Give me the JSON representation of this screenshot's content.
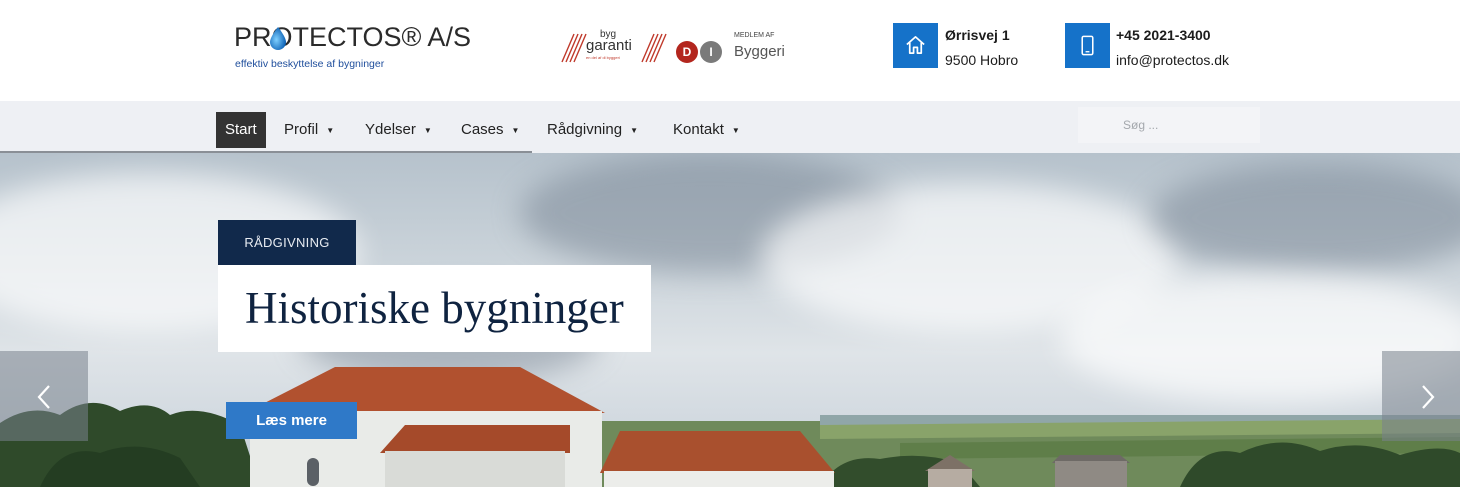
{
  "header": {
    "logo": {
      "name": "PROTECTOS® A/S",
      "tagline": "effektiv beskyttelse af bygninger"
    },
    "byg_garanti": {
      "top": "byg",
      "word": "garanti",
      "sub": "en del af di byggeri"
    },
    "di": {
      "d": "D",
      "i": "I",
      "small": "MEDLEM AF",
      "big": "Byggeri"
    },
    "address": {
      "icon": "home-icon",
      "line1": "Ørrisvej 1",
      "line2": "9500 Hobro"
    },
    "contact": {
      "icon": "phone-icon",
      "line1": "+45 2021-3400",
      "line2": "info@protectos.dk"
    }
  },
  "nav": {
    "items": [
      {
        "label": "Start",
        "active": true
      },
      {
        "label": "Profil",
        "dropdown": true
      },
      {
        "label": "Ydelser",
        "dropdown": true
      },
      {
        "label": "Cases",
        "dropdown": true
      },
      {
        "label": "Rådgivning",
        "dropdown": true
      },
      {
        "label": "Kontakt",
        "dropdown": true
      }
    ],
    "search": {
      "placeholder": "Søg ..."
    }
  },
  "hero": {
    "category": "RÅDGIVNING",
    "headline": "Historiske bygninger",
    "button": "Læs mere",
    "prev_icon": "chevron-left-icon",
    "next_icon": "chevron-right-icon"
  },
  "colors": {
    "accent": "#1572c9",
    "button": "#2f79c8",
    "tag": "#11294b",
    "nav_active": "#333333",
    "nav_bg": "#eef0f4"
  }
}
